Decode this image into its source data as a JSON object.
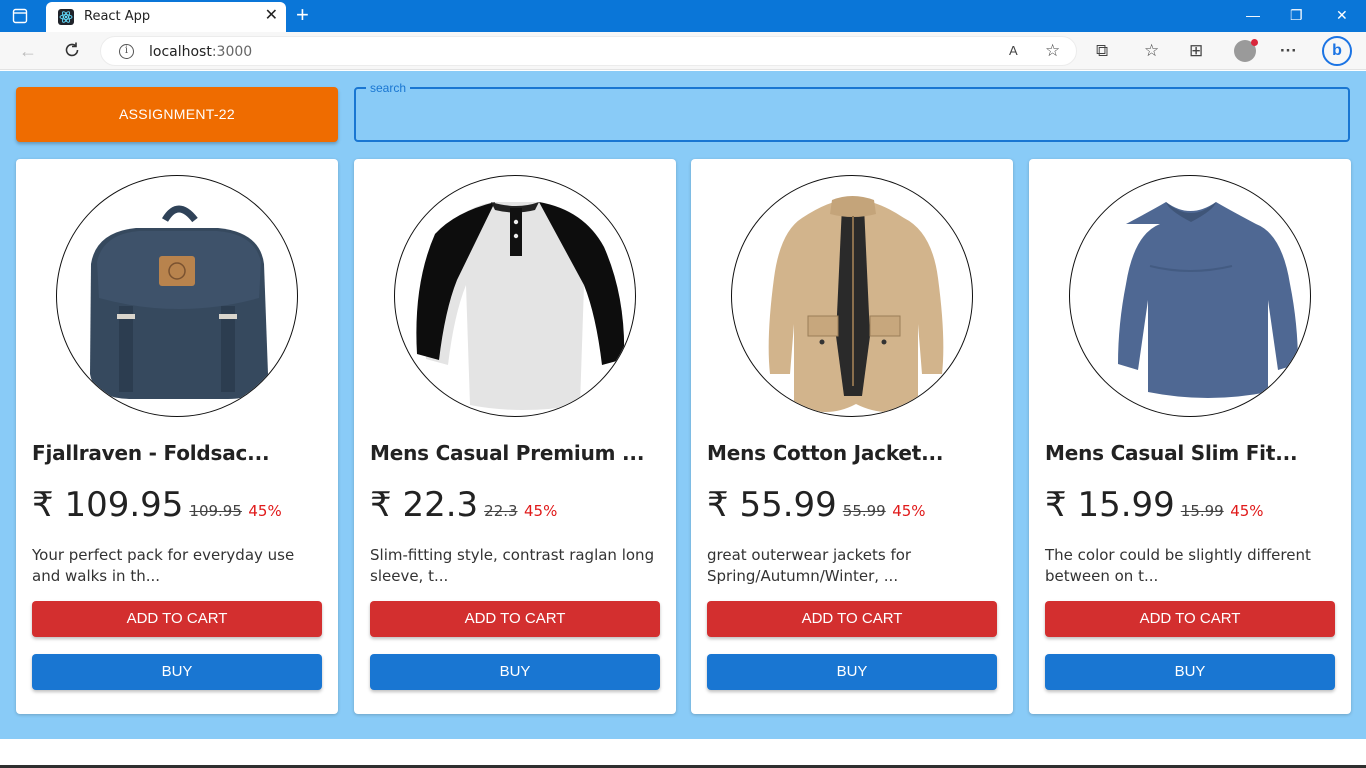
{
  "browser": {
    "tab_title": "React App",
    "tab_close": "✕",
    "new_tab": "+",
    "url_host": "localhost",
    "url_port": ":3000",
    "window_controls": {
      "minimize": "—",
      "maximize": "❐",
      "close": "✕"
    },
    "read_aloud": "A",
    "add_favorite": "☆",
    "extensions": "⧉",
    "favorites": "☆",
    "collections": "⊞",
    "menu": "···",
    "bing": "b"
  },
  "app": {
    "brand": "ASSIGNMENT-22",
    "search": {
      "label": "search",
      "value": ""
    },
    "currency": "₹",
    "products": [
      {
        "title": "Fjallraven - Foldsac...",
        "price": "₹ 109.95",
        "mrp": "109.95",
        "discount": "45%",
        "description": "Your perfect pack for everyday use and walks in th...",
        "add_to_cart": "ADD TO CART",
        "buy": "BUY",
        "image_icon": "backpack-image"
      },
      {
        "title": "Mens Casual Premium ...",
        "price": "₹ 22.3",
        "mrp": "22.3",
        "discount": "45%",
        "description": "Slim-fitting style, contrast raglan long sleeve, t...",
        "add_to_cart": "ADD TO CART",
        "buy": "BUY",
        "image_icon": "raglan-shirt-image"
      },
      {
        "title": "Mens Cotton Jacket...",
        "price": "₹ 55.99",
        "mrp": "55.99",
        "discount": "45%",
        "description": "great outerwear jackets for Spring/Autumn/Winter, ...",
        "add_to_cart": "ADD TO CART",
        "buy": "BUY",
        "image_icon": "jacket-image"
      },
      {
        "title": "Mens Casual Slim Fit...",
        "price": "₹ 15.99",
        "mrp": "15.99",
        "discount": "45%",
        "description": "The color could be slightly different between on t...",
        "add_to_cart": "ADD TO CART",
        "buy": "BUY",
        "image_icon": "tshirt-image"
      }
    ]
  },
  "colors": {
    "titlebar": "#0a76d8",
    "app_background": "#89cbf7",
    "brand_button": "#ef6c00",
    "add_to_cart": "#d32f2f",
    "buy": "#1976d2",
    "discount": "#e01a1a"
  }
}
